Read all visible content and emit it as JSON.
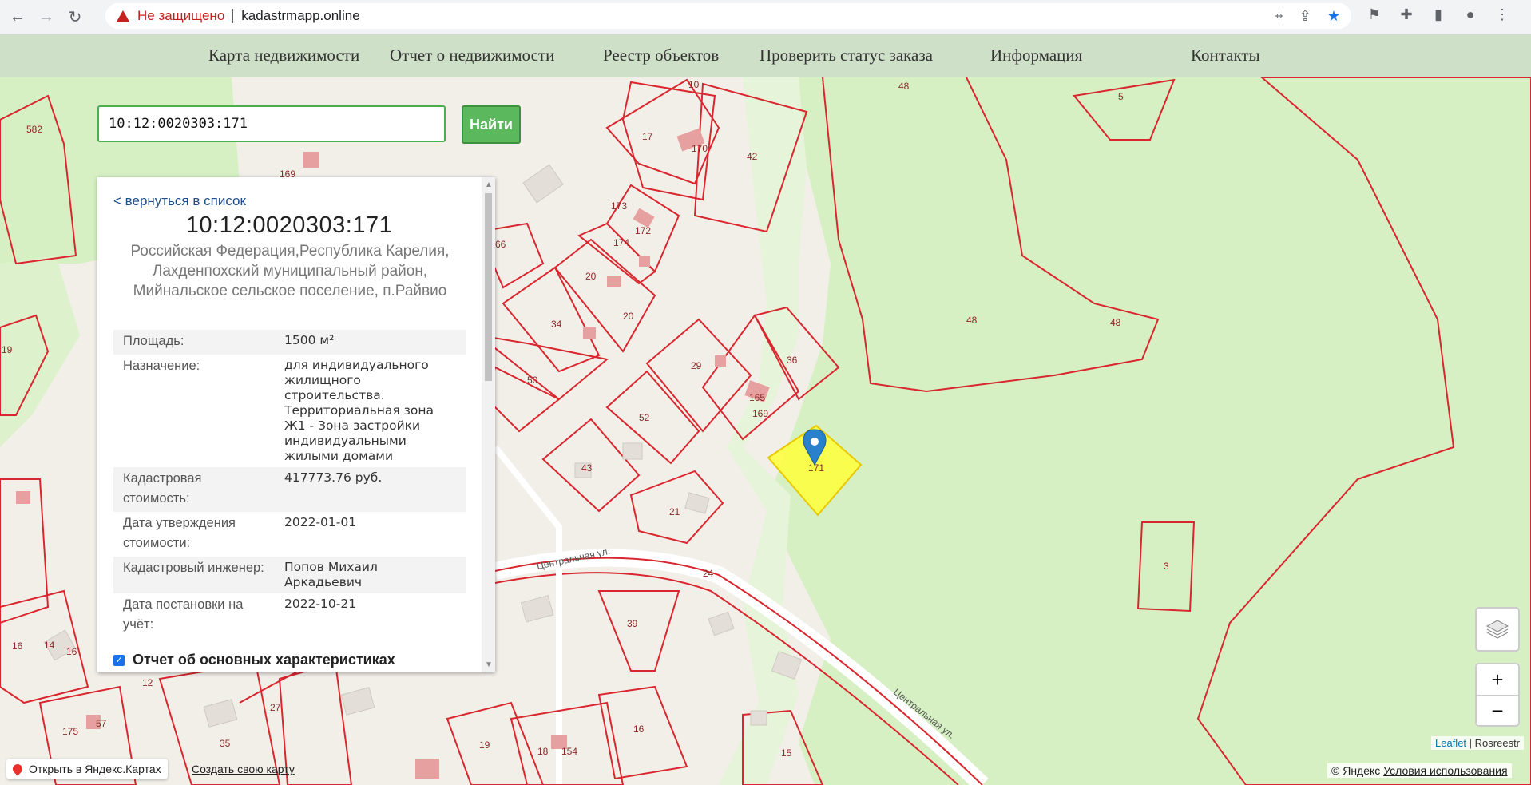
{
  "browser": {
    "insecure_label": "Не защищено",
    "url": "kadastrmapp.online"
  },
  "menu": [
    "Карта недвижимости",
    "Отчет о недвижимости",
    "Реестр объектов",
    "Проверить статус заказа",
    "Информация",
    "Контакты"
  ],
  "search": {
    "value": "10:12:0020303:171",
    "button_label": "Найти"
  },
  "panel": {
    "back_link": "< вернуться в список",
    "cadastral_number": "10:12:0020303:171",
    "address": "Российская Федерация,Республика Карелия, Лахденпохский муниципальный район, Мийнальское сельское поселение, п.Райвио",
    "properties": [
      {
        "key": "Площадь:",
        "value": "1500 м²"
      },
      {
        "key": "Назначение:",
        "value": "для индивидуального жилищного строительства. Территориальная зона Ж1 - Зона застройки индивидуальными жилыми домами"
      },
      {
        "key": "Кадастровая стоимость:",
        "value": "417773.76 руб."
      },
      {
        "key": "Дата утверждения стоимости:",
        "value": "2022-01-01"
      },
      {
        "key": "Кадастровый инженер:",
        "value": "Попов Михаил Аркадьевич"
      },
      {
        "key": "Дата постановки на учёт:",
        "value": "2022-10-21"
      }
    ],
    "report_label": "Отчет об основных характеристиках"
  },
  "map": {
    "labels": [
      "582",
      "10",
      "17",
      "170",
      "42",
      "48",
      "5",
      "169",
      "66",
      "173",
      "172",
      "174",
      "20",
      "20",
      "34",
      "50",
      "29",
      "165",
      "36",
      "48",
      "48",
      "169",
      "52",
      "43",
      "21",
      "171",
      "19",
      "3",
      "16",
      "14",
      "16",
      "12",
      "175",
      "57",
      "27",
      "35",
      "39",
      "24",
      "19",
      "18",
      "154",
      "16",
      "15"
    ],
    "street_labels": [
      "Центральная ул.",
      "Центральная ул."
    ],
    "zoom_in": "+",
    "zoom_out": "−"
  },
  "attribution": {
    "leaflet": "Leaflet",
    "rosreestr": "Rosreestr",
    "yandex_open": "Открыть в Яндекс.Картах",
    "create_map": "Создать свою карту",
    "yandex_copy": "© Яндекс",
    "terms": "Условия использования"
  },
  "colors": {
    "parcel_stroke": "#d9262f",
    "forest": "#d6f0c3",
    "selected": "#ffff3a",
    "menu_bg": "#cfe0c9",
    "button_green": "#5cb85c"
  }
}
